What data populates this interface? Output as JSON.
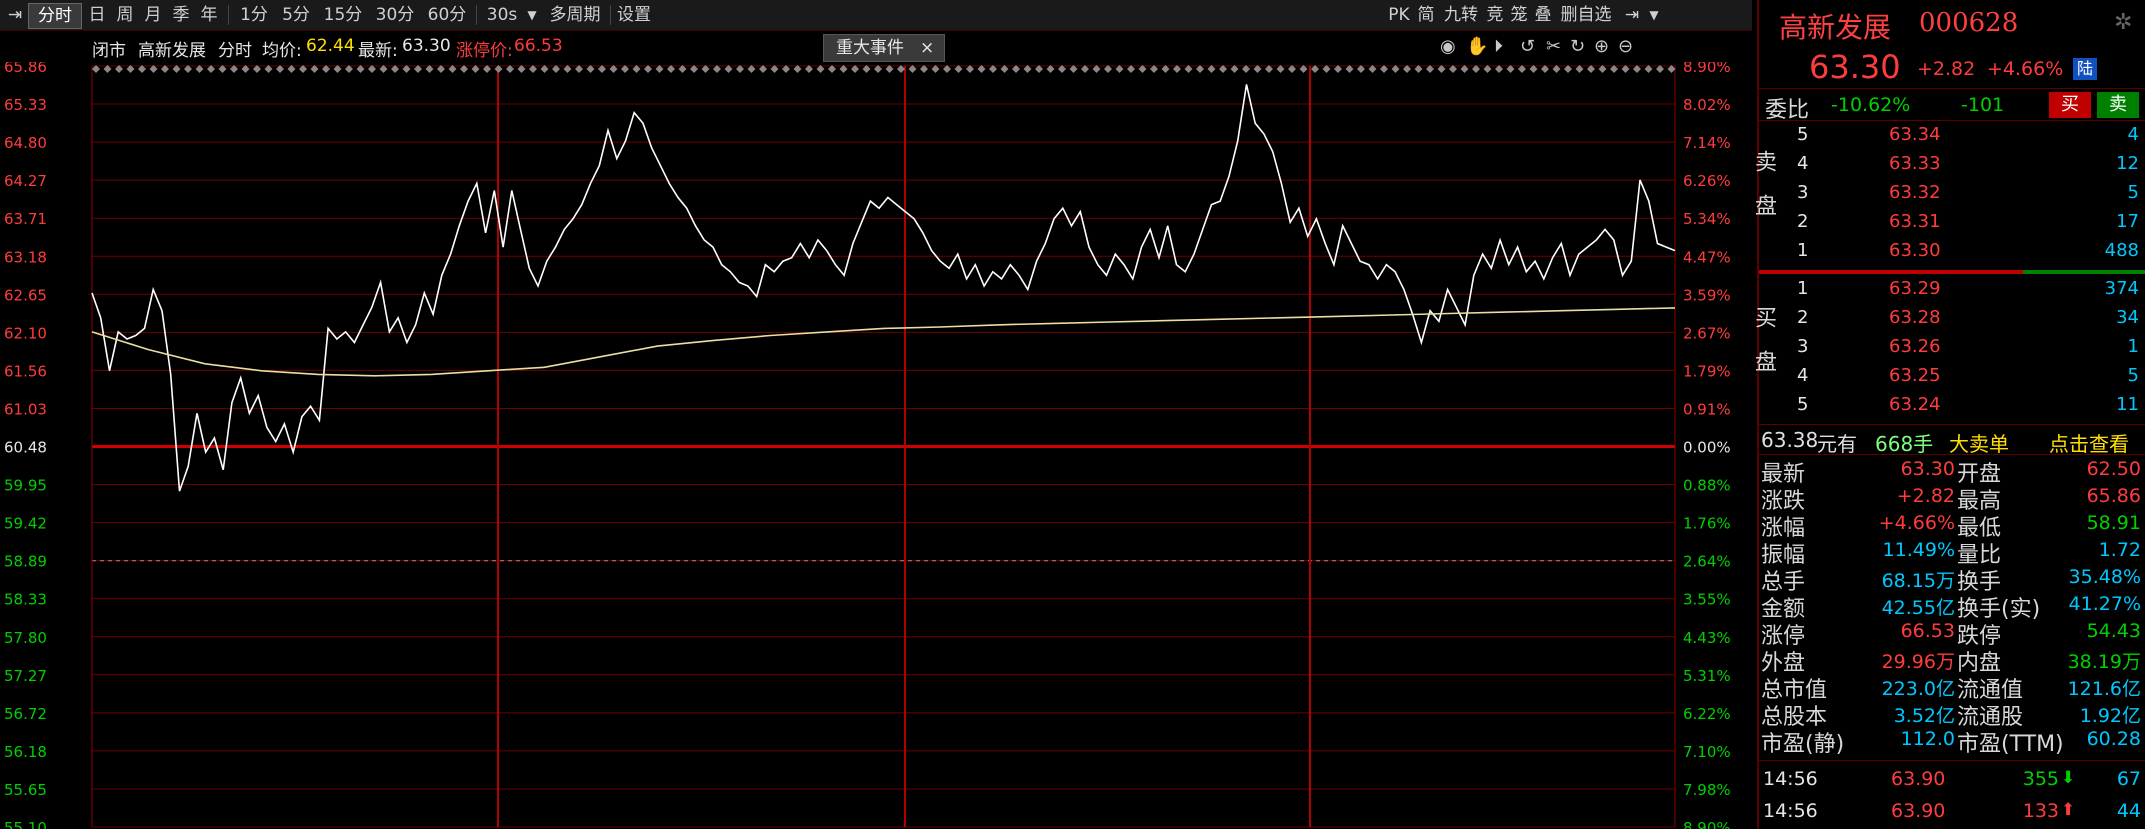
{
  "toolbar": {
    "items": [
      "分时",
      "日",
      "周",
      "月",
      "季",
      "年",
      "1分",
      "5分",
      "15分",
      "30分",
      "60分",
      "30s",
      "多周期",
      "设置"
    ],
    "right_items": [
      "PK",
      "简",
      "九转",
      "竞",
      "笼",
      "叠",
      "删自选"
    ]
  },
  "chart_header": {
    "status": "闭市",
    "name": "高新发展",
    "mode": "分时",
    "avg_label": "均价:",
    "avg_value": "62.44",
    "last_label": "最新:",
    "last_value": "63.30",
    "limit_label": "涨停价:",
    "limit_value": "66.53",
    "event_label": "重大事件",
    "event_close": "×"
  },
  "y_axis_left": [
    "65.86",
    "65.33",
    "64.80",
    "64.27",
    "63.71",
    "63.18",
    "62.65",
    "62.10",
    "61.56",
    "61.03",
    "60.48",
    "59.95",
    "59.42",
    "58.89",
    "58.33",
    "57.80",
    "57.27",
    "56.72",
    "56.18",
    "55.65",
    "55.10"
  ],
  "y_axis_right": [
    "8.90%",
    "8.02%",
    "7.14%",
    "6.26%",
    "5.34%",
    "4.47%",
    "3.59%",
    "2.67%",
    "1.79%",
    "0.91%",
    "0.00%",
    "0.88%",
    "1.76%",
    "2.64%",
    "3.55%",
    "4.43%",
    "5.31%",
    "6.22%",
    "7.10%",
    "7.98%",
    "8.90%"
  ],
  "colors": {
    "up": "#ff3c3c",
    "down": "#00d000",
    "price_line": "#ffffff",
    "avg_line": "#e8e0a0",
    "grid": "#6e0000"
  },
  "chart_data": {
    "type": "line",
    "base_price": 60.48,
    "ylim": [
      55.1,
      65.86
    ],
    "series": [
      {
        "name": "最新",
        "values": [
          62.65,
          62.3,
          61.55,
          62.1,
          62.0,
          62.05,
          62.15,
          62.7,
          62.4,
          61.5,
          59.85,
          60.2,
          60.95,
          60.4,
          60.6,
          60.15,
          61.1,
          61.45,
          60.95,
          61.2,
          60.75,
          60.55,
          60.8,
          60.4,
          60.9,
          61.05,
          60.85,
          62.15,
          62.0,
          62.1,
          61.95,
          62.2,
          62.45,
          62.8,
          62.1,
          62.3,
          61.95,
          62.2,
          62.65,
          62.35,
          62.9,
          63.2,
          63.6,
          63.95,
          64.2,
          63.5,
          64.1,
          63.3,
          64.1,
          63.55,
          63.0,
          62.75,
          63.1,
          63.3,
          63.55,
          63.7,
          63.9,
          64.2,
          64.45,
          64.95,
          64.55,
          64.8,
          65.2,
          65.05,
          64.7,
          64.45,
          64.2,
          64.0,
          63.85,
          63.6,
          63.4,
          63.3,
          63.05,
          62.95,
          62.8,
          62.75,
          62.6,
          63.05,
          62.95,
          63.1,
          63.15,
          63.35,
          63.15,
          63.4,
          63.25,
          63.05,
          62.9,
          63.35,
          63.65,
          63.95,
          63.85,
          64.0,
          63.9,
          63.8,
          63.7,
          63.5,
          63.25,
          63.1,
          63.0,
          63.2,
          62.85,
          63.05,
          62.75,
          62.95,
          62.85,
          63.05,
          62.9,
          62.7,
          63.1,
          63.35,
          63.7,
          63.85,
          63.6,
          63.8,
          63.3,
          63.05,
          62.9,
          63.2,
          63.05,
          62.85,
          63.3,
          63.55,
          63.15,
          63.6,
          63.05,
          62.95,
          63.2,
          63.55,
          63.9,
          63.95,
          64.3,
          64.8,
          65.6,
          65.05,
          64.9,
          64.65,
          64.2,
          63.65,
          63.85,
          63.45,
          63.7,
          63.35,
          63.05,
          63.6,
          63.35,
          63.1,
          63.05,
          62.85,
          63.05,
          62.95,
          62.7,
          62.35,
          61.95,
          62.4,
          62.25,
          62.7,
          62.45,
          62.2,
          62.9,
          63.2,
          63.0,
          63.4,
          63.05,
          63.3,
          62.95,
          63.1,
          62.85,
          63.15,
          63.35,
          62.9,
          63.2,
          63.3,
          63.4,
          63.55,
          63.4,
          62.9,
          63.1,
          64.25,
          63.95,
          63.35,
          63.3,
          63.25
        ],
        "x_note": "09:30-15:00"
      },
      {
        "name": "均价",
        "values": [
          62.1,
          61.85,
          61.65,
          61.55,
          61.5,
          61.48,
          61.5,
          61.55,
          61.6,
          61.75,
          61.9,
          61.98,
          62.05,
          62.1,
          62.15,
          62.17,
          62.2,
          62.22,
          62.24,
          62.26,
          62.28,
          62.3,
          62.32,
          62.34,
          62.36,
          62.38,
          62.4,
          62.42,
          62.44
        ]
      }
    ]
  },
  "panel": {
    "title_name": "高新发展",
    "title_code": "000628",
    "price": "63.30",
    "change": "+2.82",
    "change_pct": "+4.66%",
    "market_badge": "陆",
    "weibi_label": "委比",
    "weibi_pct": "-10.62%",
    "weibi_diff": "-101",
    "buy_btn": "买",
    "sell_btn": "卖",
    "sell_side": "卖盘",
    "buy_side": "买盘",
    "asks": [
      {
        "level": "5",
        "price": "63.34",
        "vol": "4"
      },
      {
        "level": "4",
        "price": "63.33",
        "vol": "12"
      },
      {
        "level": "3",
        "price": "63.32",
        "vol": "5"
      },
      {
        "level": "2",
        "price": "63.31",
        "vol": "17"
      },
      {
        "level": "1",
        "price": "63.30",
        "vol": "488"
      }
    ],
    "bids": [
      {
        "level": "1",
        "price": "63.29",
        "vol": "374"
      },
      {
        "level": "2",
        "price": "63.28",
        "vol": "34"
      },
      {
        "level": "3",
        "price": "63.26",
        "vol": "1"
      },
      {
        "level": "4",
        "price": "63.25",
        "vol": "5"
      },
      {
        "level": "5",
        "price": "63.24",
        "vol": "11"
      }
    ],
    "bigorder": {
      "price": "63.38",
      "unit1": "元有",
      "qty": "668手",
      "label": "大卖单",
      "link": "点击查看"
    },
    "stats": [
      [
        "最新",
        "63.30",
        "开盘",
        "62.50"
      ],
      [
        "涨跌",
        "+2.82",
        "最高",
        "65.86"
      ],
      [
        "涨幅",
        "+4.66%",
        "最低",
        "58.91"
      ],
      [
        "振幅",
        "11.49%",
        "量比",
        "1.72"
      ],
      [
        "总手",
        "68.15万",
        "换手",
        "35.48%"
      ],
      [
        "金额",
        "42.55亿",
        "换手(实)",
        "41.27%"
      ],
      [
        "涨停",
        "66.53",
        "跌停",
        "54.43"
      ],
      [
        "外盘",
        "29.96万",
        "内盘",
        "38.19万"
      ],
      [
        "总市值",
        "223.0亿",
        "流通值",
        "121.6亿"
      ],
      [
        "总股本",
        "3.52亿",
        "流通股",
        "1.92亿"
      ],
      [
        "市盈(静)",
        "112.0",
        "市盈(TTM)",
        "60.28"
      ]
    ],
    "ticks": [
      {
        "time": "14:56",
        "price": "63.90",
        "vol": "355",
        "dir": "down",
        "n": "67"
      },
      {
        "time": "14:56",
        "price": "63.90",
        "vol": "133",
        "dir": "up",
        "n": "44"
      }
    ]
  }
}
